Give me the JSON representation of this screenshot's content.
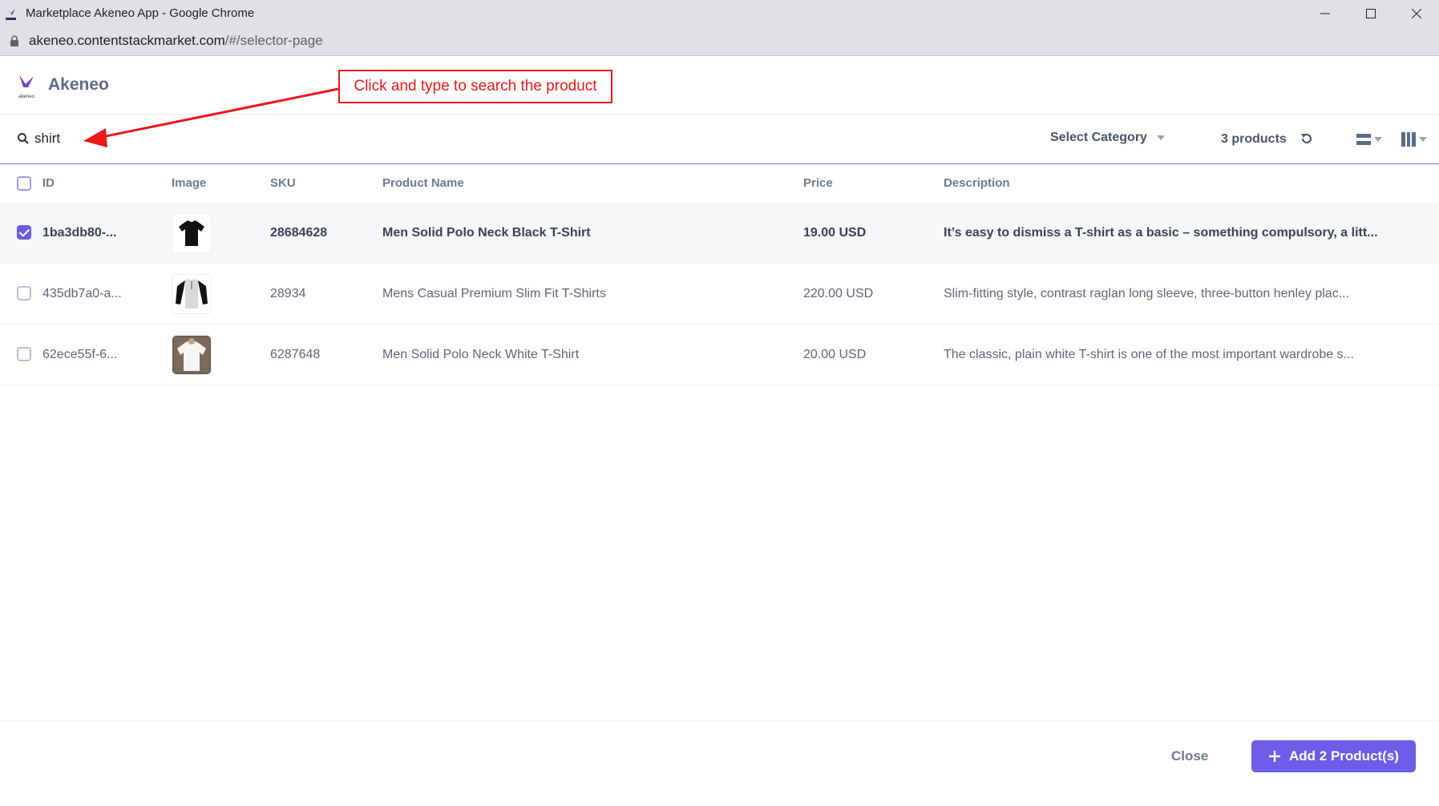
{
  "browser": {
    "window_title": "Marketplace Akeneo App - Google Chrome",
    "url_host": "akeneo.contentstackmarket.com",
    "url_path": "/#/selector-page"
  },
  "app": {
    "name": "Akeneo",
    "logo_caption": "akeneo"
  },
  "annotation": {
    "text": "Click and type to search the product",
    "color": "#e8181b"
  },
  "toolbar": {
    "search_value": "shirt",
    "category_label": "Select Category",
    "product_count": "3 products"
  },
  "table": {
    "columns": [
      "ID",
      "Image",
      "SKU",
      "Product Name",
      "Price",
      "Description"
    ],
    "rows": [
      {
        "selected": true,
        "id": "1ba3db80-...",
        "image": "black-tshirt",
        "sku": "28684628",
        "name": "Men Solid Polo Neck Black T-Shirt",
        "price": "19.00 USD",
        "description": "It’s easy to dismiss a T-shirt as a basic – something compulsory, a litt..."
      },
      {
        "selected": false,
        "id": "435db7a0-a...",
        "image": "raglan-henley-tshirt",
        "sku": "28934",
        "name": "Mens Casual Premium Slim Fit T-Shirts",
        "price": "220.00 USD",
        "description": "Slim-fitting style, contrast raglan long sleeve, three-button henley plac..."
      },
      {
        "selected": false,
        "id": "62ece55f-6...",
        "image": "white-tshirt",
        "sku": "6287648",
        "name": "Men Solid Polo Neck White T-Shirt",
        "price": "20.00 USD",
        "description": "The classic, plain white T-shirt is one of the most important wardrobe s..."
      }
    ]
  },
  "footer": {
    "close_label": "Close",
    "add_label": "Add 2 Product(s)"
  },
  "colors": {
    "accent": "#6c5ce7",
    "annotation_red": "#e8181b"
  }
}
